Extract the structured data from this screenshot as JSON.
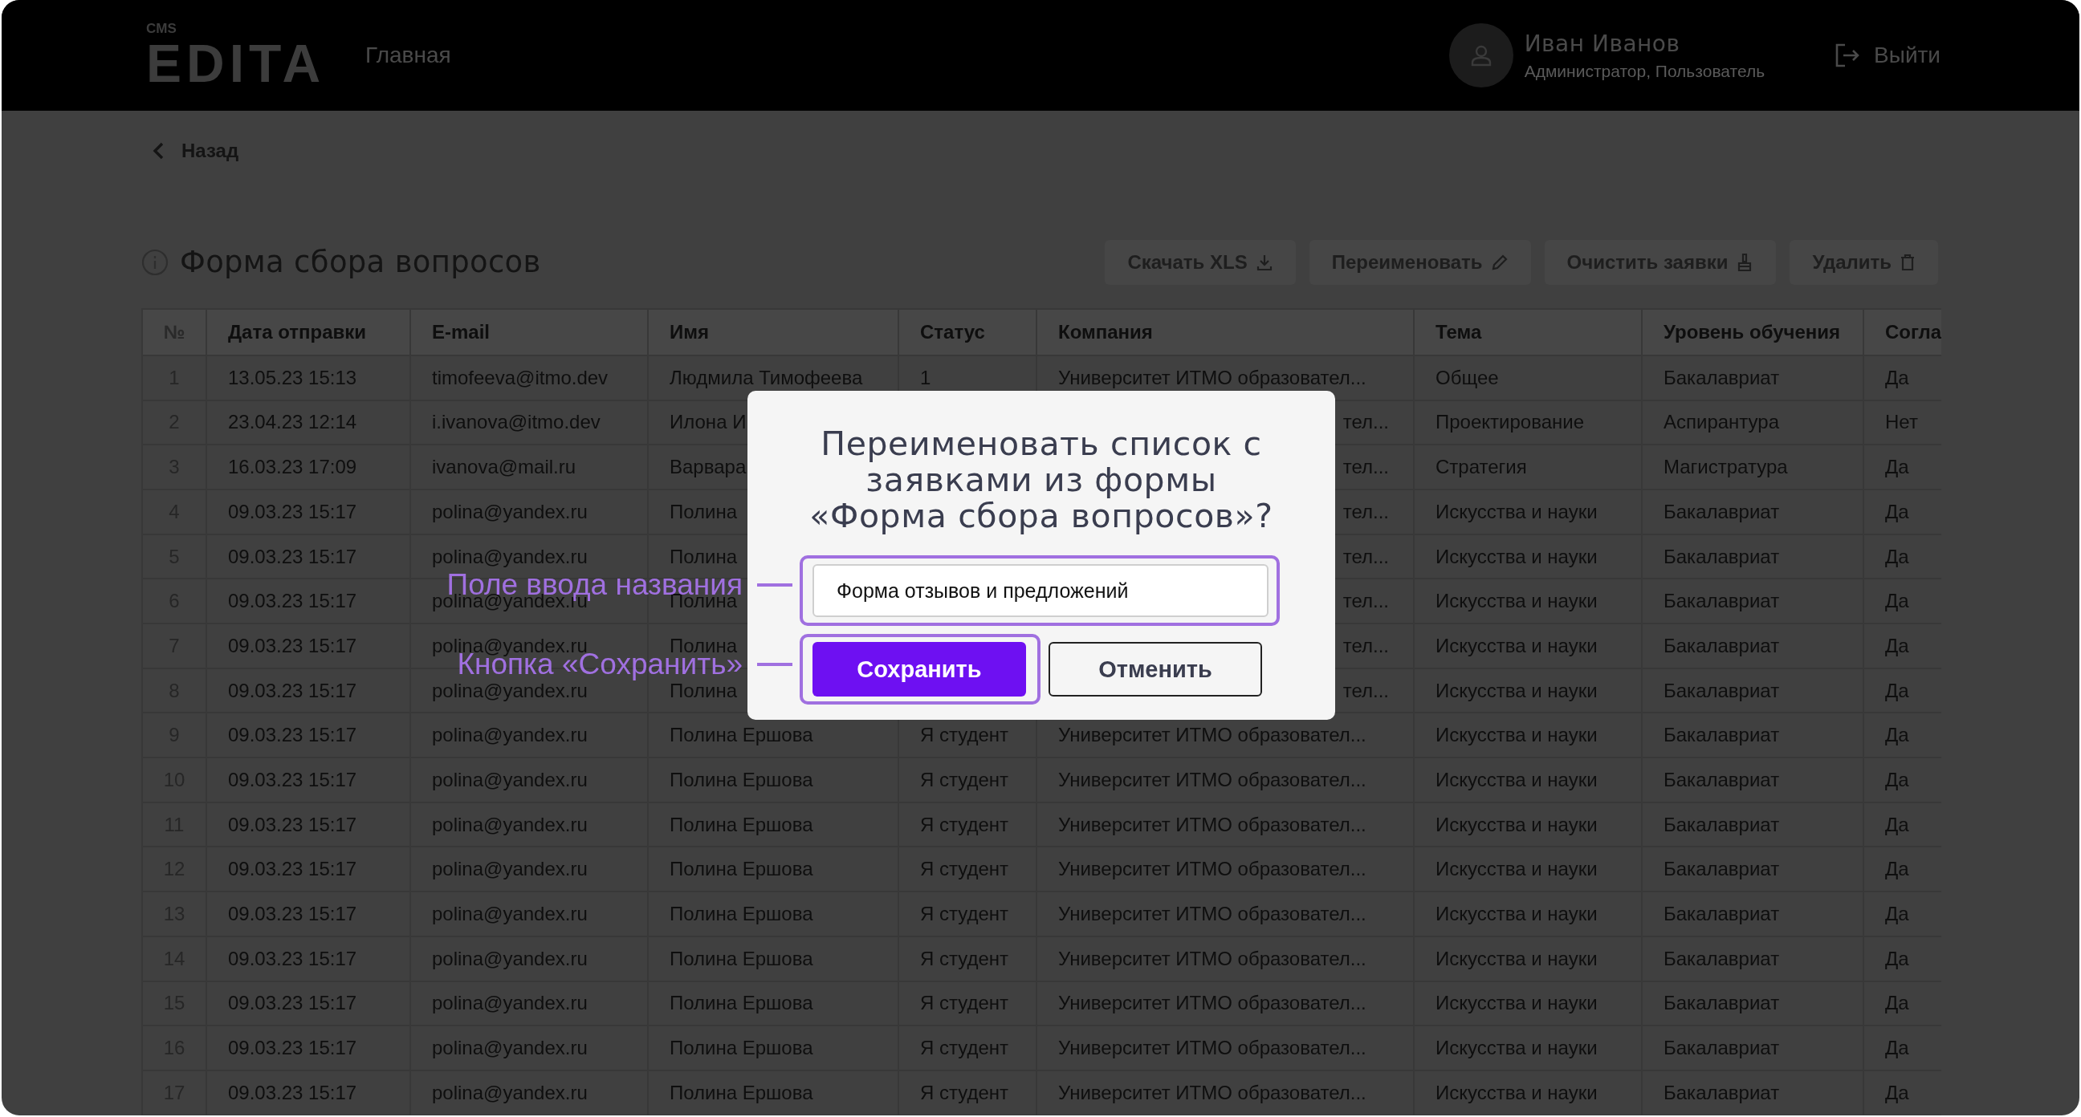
{
  "header": {
    "logo_small": "CMS",
    "logo": "EDITA",
    "nav": [
      {
        "label": "Главная",
        "selected": false
      }
    ],
    "user": {
      "name": "Иван Иванов",
      "role": "Администратор, Пользователь"
    },
    "logout": "Выйти"
  },
  "back": "Назад",
  "page": {
    "title": "Форма сбора вопросов",
    "actions": [
      {
        "label": "Скачать XLS"
      },
      {
        "label": "Переименовать"
      },
      {
        "label": "Очистить заявки"
      },
      {
        "label": "Удалить"
      }
    ]
  },
  "table": {
    "columns": [
      "№",
      "Дата отправки",
      "E-mail",
      "Имя",
      "Статус",
      "Компания",
      "Тема",
      "Уровень обучения",
      "Согла"
    ],
    "rows": [
      {
        "n": "1",
        "date": "13.05.23 15:13",
        "email": "timofeeva@itmo.dev",
        "name": "Людмила Тимофеева",
        "status": "1",
        "company": "Университет ИТМО образовател...",
        "topic": "Общее",
        "level_of_study": "Бакалавриат",
        "agree": "Да"
      },
      {
        "n": "2",
        "date": "23.04.23 12:14",
        "email": "i.ivanova@itmo.dev",
        "name": "Илона И",
        "company": "тел...",
        "topic": "Проектирование",
        "level_of_study": "Аспирантура",
        "agree": "Нет"
      },
      {
        "n": "3",
        "date": "16.03.23 17:09",
        "email": "ivanova@mail.ru",
        "name": "Варвара",
        "company": "тел...",
        "topic": "Стратегия",
        "level_of_study": "Магистратура",
        "agree": "Да"
      },
      {
        "n": "4",
        "date": "09.03.23 15:17",
        "email": "polina@yandex.ru",
        "name": "Полина",
        "company": "тел...",
        "topic": "Искусства и науки",
        "level_of_study": "Бакалавриат",
        "agree": "Да"
      },
      {
        "n": "5",
        "date": "09.03.23 15:17",
        "email": "polina@yandex.ru",
        "name": "Полина",
        "company": "тел...",
        "topic": "Искусства и науки",
        "level_of_study": "Бакалавриат",
        "agree": "Да"
      },
      {
        "n": "6",
        "date": "09.03.23 15:17",
        "email": "polina@yandex.ru",
        "name": "Полина",
        "company": "тел...",
        "topic": "Искусства и науки",
        "level_of_study": "Бакалавриат",
        "agree": "Да"
      },
      {
        "n": "7",
        "date": "09.03.23 15:17",
        "email": "polina@yandex.ru",
        "name": "Полина",
        "company": "тел...",
        "topic": "Искусства и науки",
        "level_of_study": "Бакалавриат",
        "agree": "Да"
      },
      {
        "n": "8",
        "date": "09.03.23 15:17",
        "email": "polina@yandex.ru",
        "name": "Полина",
        "company": "тел...",
        "topic": "Искусства и науки",
        "level_of_study": "Бакалавриат",
        "agree": "Да"
      },
      {
        "n": "9",
        "date": "09.03.23 15:17",
        "email": "polina@yandex.ru",
        "name": "Полина Ершова",
        "status": "Я студент",
        "company": "Университет ИТМО образовател...",
        "topic": "Искусства и науки",
        "level_of_study": "Бакалавриат",
        "agree": "Да"
      },
      {
        "n": "10",
        "date": "09.03.23 15:17",
        "email": "polina@yandex.ru",
        "name": "Полина Ершова",
        "status": "Я студент",
        "company": "Университет ИТМО образовател...",
        "topic": "Искусства и науки",
        "level_of_study": "Бакалавриат",
        "agree": "Да"
      },
      {
        "n": "11",
        "date": "09.03.23 15:17",
        "email": "polina@yandex.ru",
        "name": "Полина Ершова",
        "status": "Я студент",
        "company": "Университет ИТМО образовател...",
        "topic": "Искусства и науки",
        "level_of_study": "Бакалавриат",
        "agree": "Да"
      },
      {
        "n": "12",
        "date": "09.03.23 15:17",
        "email": "polina@yandex.ru",
        "name": "Полина Ершова",
        "status": "Я студент",
        "company": "Университет ИТМО образовател...",
        "topic": "Искусства и науки",
        "level_of_study": "Бакалавриат",
        "agree": "Да"
      },
      {
        "n": "13",
        "date": "09.03.23 15:17",
        "email": "polina@yandex.ru",
        "name": "Полина Ершова",
        "status": "Я студент",
        "company": "Университет ИТМО образовател...",
        "topic": "Искусства и науки",
        "level_of_study": "Бакалавриат",
        "agree": "Да"
      },
      {
        "n": "14",
        "date": "09.03.23 15:17",
        "email": "polina@yandex.ru",
        "name": "Полина Ершова",
        "status": "Я студент",
        "company": "Университет ИТМО образовател...",
        "topic": "Искусства и науки",
        "level_of_study": "Бакалавриат",
        "agree": "Да"
      },
      {
        "n": "15",
        "date": "09.03.23 15:17",
        "email": "polina@yandex.ru",
        "name": "Полина Ершова",
        "status": "Я студент",
        "company": "Университет ИТМО образовател...",
        "topic": "Искусства и науки",
        "level_of_study": "Бакалавриат",
        "agree": "Да"
      },
      {
        "n": "16",
        "date": "09.03.23 15:17",
        "email": "polina@yandex.ru",
        "name": "Полина Ершова",
        "status": "Я студент",
        "company": "Университет ИТМО образовател...",
        "topic": "Искусства и науки",
        "level_of_study": "Бакалавриат",
        "agree": "Да"
      },
      {
        "n": "17",
        "date": "09.03.23 15:17",
        "email": "polina@yandex.ru",
        "name": "Полина Ершова",
        "status": "Я студент",
        "company": "Университет ИТМО образовател...",
        "topic": "Искусства и науки",
        "level_of_study": "Бакалавриат",
        "agree": "Да"
      }
    ]
  },
  "dialog": {
    "title": "Переименовать список с заявками из формы «Форма сбора вопросов»?",
    "value": "Форма отзывов и предложений",
    "buttons": [
      {
        "label": "Сохранить",
        "kind": "primary"
      },
      {
        "label": "Отменить",
        "kind": "secondary"
      }
    ]
  },
  "annotations": [
    "Поле ввода названия",
    "Кнопка «Сохранить»"
  ]
}
